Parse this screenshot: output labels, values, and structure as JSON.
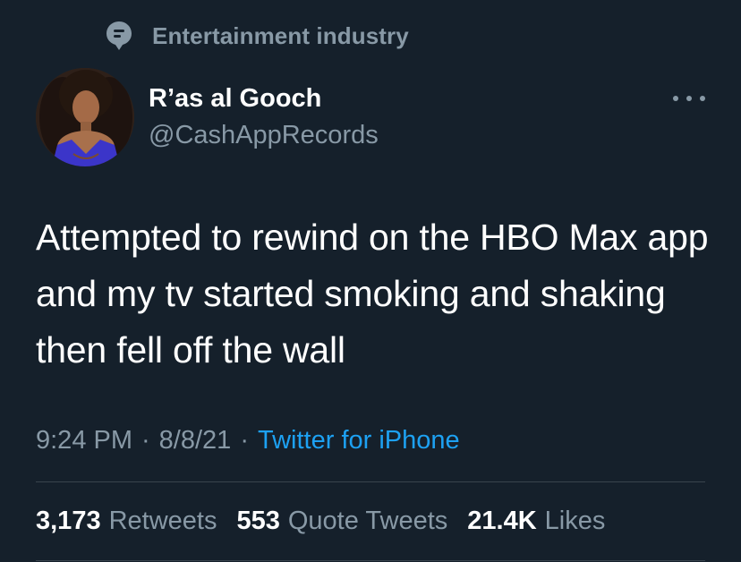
{
  "colors": {
    "background": "#15202b",
    "primary_text": "#ffffff",
    "secondary_text": "#8899a6",
    "link": "#1da1f2",
    "divider": "#38444d"
  },
  "topic": {
    "icon": "topic-bubble-icon",
    "label": "Entertainment industry"
  },
  "author": {
    "display_name": "R’as al Gooch",
    "handle": "@CashAppRecords",
    "avatar": "avatar-photo"
  },
  "tweet": {
    "text": "Attempted to rewind on the HBO Max app and my tv started smoking and shaking then fell off the wall"
  },
  "meta": {
    "time": "9:24 PM",
    "separator": "·",
    "date": "8/8/21",
    "source": "Twitter for iPhone"
  },
  "stats": {
    "retweets": {
      "count": "3,173",
      "label": "Retweets"
    },
    "quote_tweets": {
      "count": "553",
      "label": "Quote Tweets"
    },
    "likes": {
      "count": "21.4K",
      "label": "Likes"
    }
  },
  "more_icon": "more-horizontal-icon"
}
